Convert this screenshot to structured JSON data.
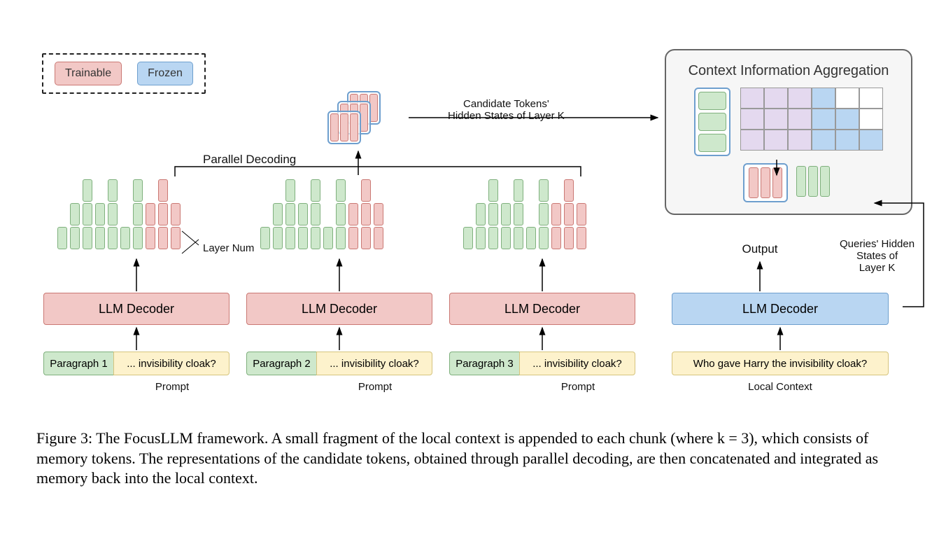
{
  "legend": {
    "trainable": "Trainable",
    "frozen": "Frozen"
  },
  "labels": {
    "parallel_decoding": "Parallel Decoding",
    "candidate_tokens": "Candidate Tokens'\nHidden States of Layer K",
    "layer_num": "Layer Num",
    "output": "Output",
    "queries_hidden": "Queries' Hidden\nStates of\nLayer K",
    "prompt": "Prompt",
    "local_context": "Local Context",
    "aggregation_title": "Context Information Aggregation"
  },
  "decoders": [
    {
      "text": "LLM Decoder",
      "type": "red"
    },
    {
      "text": "LLM Decoder",
      "type": "red"
    },
    {
      "text": "LLM Decoder",
      "type": "red"
    },
    {
      "text": "LLM Decoder",
      "type": "blue"
    }
  ],
  "inputs": [
    {
      "left": "Paragraph 1",
      "right": "... invisibility cloak?"
    },
    {
      "left": "Paragraph 2",
      "right": "... invisibility cloak?"
    },
    {
      "left": "Paragraph 3",
      "right": "... invisibility cloak?"
    }
  ],
  "local_context_text": "Who gave Harry the invisibility cloak?",
  "caption": "Figure 3: The FocusLLM framework. A small fragment of the local context is appended to each chunk (where k = 3), which consists of memory tokens. The representations of the candidate tokens, obtained through parallel decoding, are then concatenated and integrated as memory back into the local context."
}
